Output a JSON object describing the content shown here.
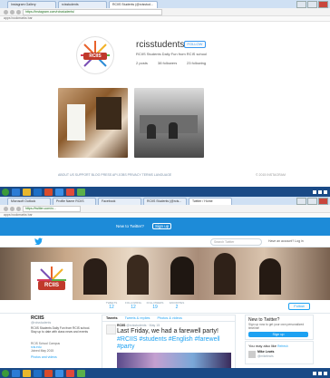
{
  "top": {
    "tabs": [
      "Instagram Gallery",
      "rcisstudents",
      "RCIIS Students (@rcisstud..."
    ],
    "url": "https://instagram.com/rcisstudents/",
    "bookmarks": "apps  bookmarks bar",
    "profile": {
      "username": "rcisstudents",
      "follow_label": "FOLLOW",
      "bio": "RCIIS Students Daily Fun from RCIS school",
      "posts": "2 posts",
      "followers": "38 followers",
      "following": "23 following"
    },
    "footer_links": "ABOUT US  SUPPORT  BLOG  PRESS  API  JOBS  PRIVACY  TERMS  LANGUAGE",
    "footer_copy": "© 2015 INSTAGRAM"
  },
  "bottom": {
    "tabs": [
      "Microsoft Outlook",
      "Profile Name RCIIS",
      "Facebook",
      "RCIIS Students (@rcis...",
      "Twitter / Home"
    ],
    "url": "https://twitter.com/rc...",
    "bookmarks": "apps  bookmarks bar",
    "signin_bar": {
      "prompt": "New to Twitter?",
      "signup": "Sign up"
    },
    "search_placeholder": "Search Twitter",
    "have_account": "Have an account? Log in",
    "stats": [
      {
        "label": "TWEETS",
        "value": "12"
      },
      {
        "label": "FOLLOWING",
        "value": "12"
      },
      {
        "label": "FOLLOWERS",
        "value": "19"
      },
      {
        "label": "FAVORITES",
        "value": "2"
      }
    ],
    "follow_label": "Follow",
    "profile": {
      "name": "RCIIS",
      "handle": "@rcisstudents",
      "bio": "RCIIS Students Daily Fun from RCIS school. Stay up to date with class news and events",
      "location": "RCIS School Campus",
      "link": "rcis.edu",
      "joined": "Joined May 2015",
      "photos_label": "Photos and videos"
    },
    "content_tabs": [
      "Tweets",
      "Tweets & replies",
      "Photos & videos"
    ],
    "tweet": {
      "author": "RCIIS",
      "meta": "@rcisstudents · May 15",
      "text": "Last Friday, we had a farewell party!",
      "hashtags": "#RCIIS #students #English #farewell #party"
    },
    "signup_panel": {
      "title": "New to Twitter?",
      "desc": "Sign up now to get your own personalized timeline!",
      "button": "Sign up"
    },
    "suggest": {
      "title": "You may also like",
      "refresh": "Refresh",
      "user": "Mike Lewis",
      "handle": "@mikelewis"
    }
  },
  "logo_text": "RCIIS",
  "colors": {
    "twitter_blue": "#1da1f2",
    "taskbar": "#1a4a86",
    "tab_bar": "#cfe0f3"
  }
}
